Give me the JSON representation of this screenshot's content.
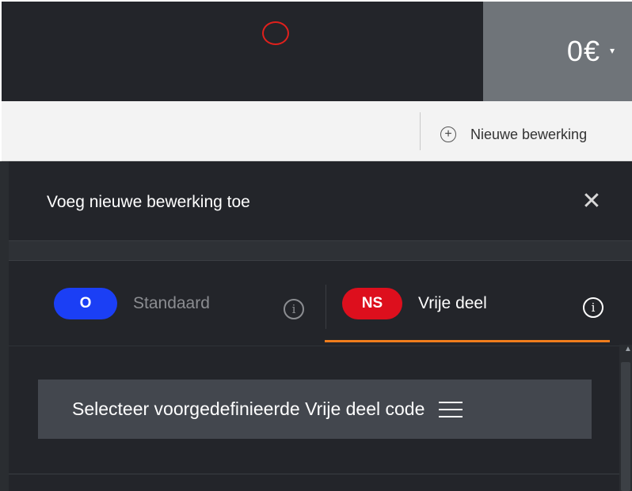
{
  "header": {
    "balance": "0€",
    "balance_caret": "▾"
  },
  "toolbar": {
    "new_operation_label": "Nieuwe bewerking",
    "new_operation_icon": "plus-circle-icon"
  },
  "panel": {
    "title": "Voeg nieuwe bewerking toe",
    "close_icon": "✕",
    "tabs": [
      {
        "badge": "O",
        "label": "Standaard",
        "badge_color": "#1b3ff5",
        "active": false
      },
      {
        "badge": "NS",
        "label": "Vrije deel",
        "badge_color": "#dd0f1d",
        "active": true
      }
    ],
    "info_glyph": "i",
    "active_underline_color": "#f07d1d",
    "select_button_label": "Selecteer voorgedefinieerde Vrije deel code"
  }
}
